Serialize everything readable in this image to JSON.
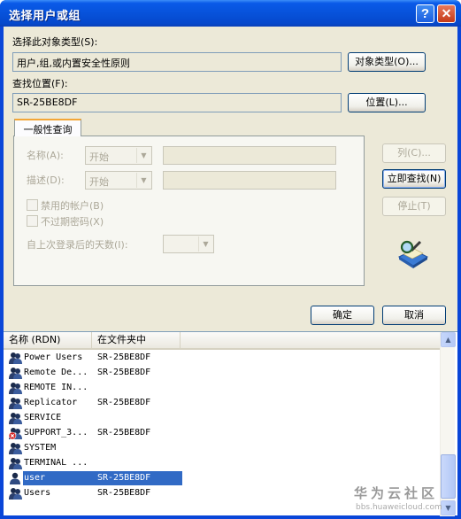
{
  "window": {
    "title": "选择用户或组",
    "help_label": "?",
    "close_label": "✕"
  },
  "object_type": {
    "label": "选择此对象类型(S):",
    "value": "用户,组,或内置安全性原则",
    "button": "对象类型(O)..."
  },
  "location": {
    "label": "查找位置(F):",
    "value": "SR-25BE8DF",
    "button": "位置(L)..."
  },
  "query": {
    "tab": "一般性查询",
    "name_label": "名称(A):",
    "name_mode": "开始",
    "desc_label": "描述(D):",
    "desc_mode": "开始",
    "disabled_accounts": "禁用的帐户(B)",
    "non_expiring": "不过期密码(X)",
    "days_label": "自上次登录后的天数(I):"
  },
  "side_buttons": {
    "columns": "列(C)...",
    "find_now": "立即查找(N)",
    "stop": "停止(T)"
  },
  "actions": {
    "ok": "确定",
    "cancel": "取消"
  },
  "results": {
    "columns": [
      "名称 (RDN)",
      "在文件夹中"
    ],
    "rows": [
      {
        "name": "Power Users",
        "folder": "SR-25BE8DF",
        "icon": "group-icon"
      },
      {
        "name": "Remote De...",
        "folder": "SR-25BE8DF",
        "icon": "group-icon"
      },
      {
        "name": "REMOTE IN...",
        "folder": "",
        "icon": "group-icon"
      },
      {
        "name": "Replicator",
        "folder": "SR-25BE8DF",
        "icon": "group-icon"
      },
      {
        "name": "SERVICE",
        "folder": "",
        "icon": "group-icon"
      },
      {
        "name": "SUPPORT_3...",
        "folder": "SR-25BE8DF",
        "icon": "disabled-user-icon"
      },
      {
        "name": "SYSTEM",
        "folder": "",
        "icon": "group-icon"
      },
      {
        "name": "TERMINAL ...",
        "folder": "",
        "icon": "group-icon"
      },
      {
        "name": "user",
        "folder": "SR-25BE8DF",
        "icon": "user-icon",
        "selected": true
      },
      {
        "name": "Users",
        "folder": "SR-25BE8DF",
        "icon": "group-icon"
      }
    ]
  },
  "watermark": {
    "brand": "华为云社区",
    "url": "bbs.huaweicloud.com"
  },
  "colors": {
    "titlebar": "#0752da",
    "selection": "#316ac5",
    "dialog_bg": "#ece9d8"
  }
}
